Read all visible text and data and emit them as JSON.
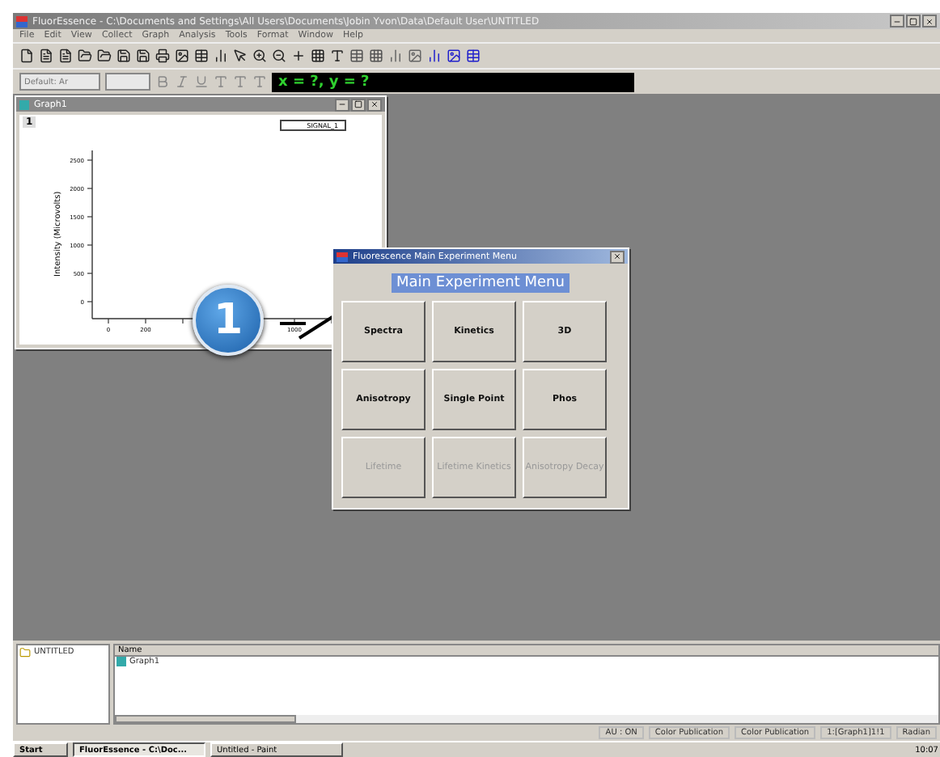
{
  "window": {
    "title": "FluorEssence - C:\\Documents and Settings\\All Users\\Documents\\Jobin Yvon\\Data\\Default User\\UNTITLED"
  },
  "menu": [
    "File",
    "Edit",
    "View",
    "Collect",
    "Graph",
    "Analysis",
    "Tools",
    "Format",
    "Window",
    "Help"
  ],
  "format_bar": {
    "font": "Default: Ar",
    "readout": "x = ?, y = ?"
  },
  "graph_window": {
    "title": "Graph1",
    "layer": "1",
    "legend": "SIGNAL_1",
    "ylabel": "Intensity (Microvolts)",
    "yticks": [
      "2500",
      "2000",
      "1500",
      "1000",
      "500",
      "0"
    ],
    "xticks": [
      "0",
      "200",
      "1000"
    ]
  },
  "callout": {
    "label": "1"
  },
  "dialog": {
    "title": "Fluorescence Main Experiment Menu",
    "heading": "Main Experiment Menu",
    "buttons": [
      {
        "label": "Spectra",
        "disabled": false
      },
      {
        "label": "Kinetics",
        "disabled": false
      },
      {
        "label": "3D",
        "disabled": false
      },
      {
        "label": "Anisotropy",
        "disabled": false
      },
      {
        "label": "Single Point",
        "disabled": false
      },
      {
        "label": "Phos",
        "disabled": false
      },
      {
        "label": "Lifetime",
        "disabled": true
      },
      {
        "label": "Lifetime Kinetics",
        "disabled": true
      },
      {
        "label": "Anisotropy Decay",
        "disabled": true
      }
    ]
  },
  "explorer": {
    "folder": "UNTITLED",
    "column": "Name",
    "items": [
      "Graph1"
    ]
  },
  "status_bar": [
    "AU : ON",
    "Color Publication",
    "Color Publication",
    "1:[Graph1]1!1",
    "Radian"
  ],
  "taskbar": {
    "start": "Start",
    "tasks": [
      {
        "label": "FluorEssence - C:\\Doc...",
        "selected": true
      },
      {
        "label": "Untitled - Paint",
        "selected": false
      }
    ],
    "clock": "10:07"
  }
}
